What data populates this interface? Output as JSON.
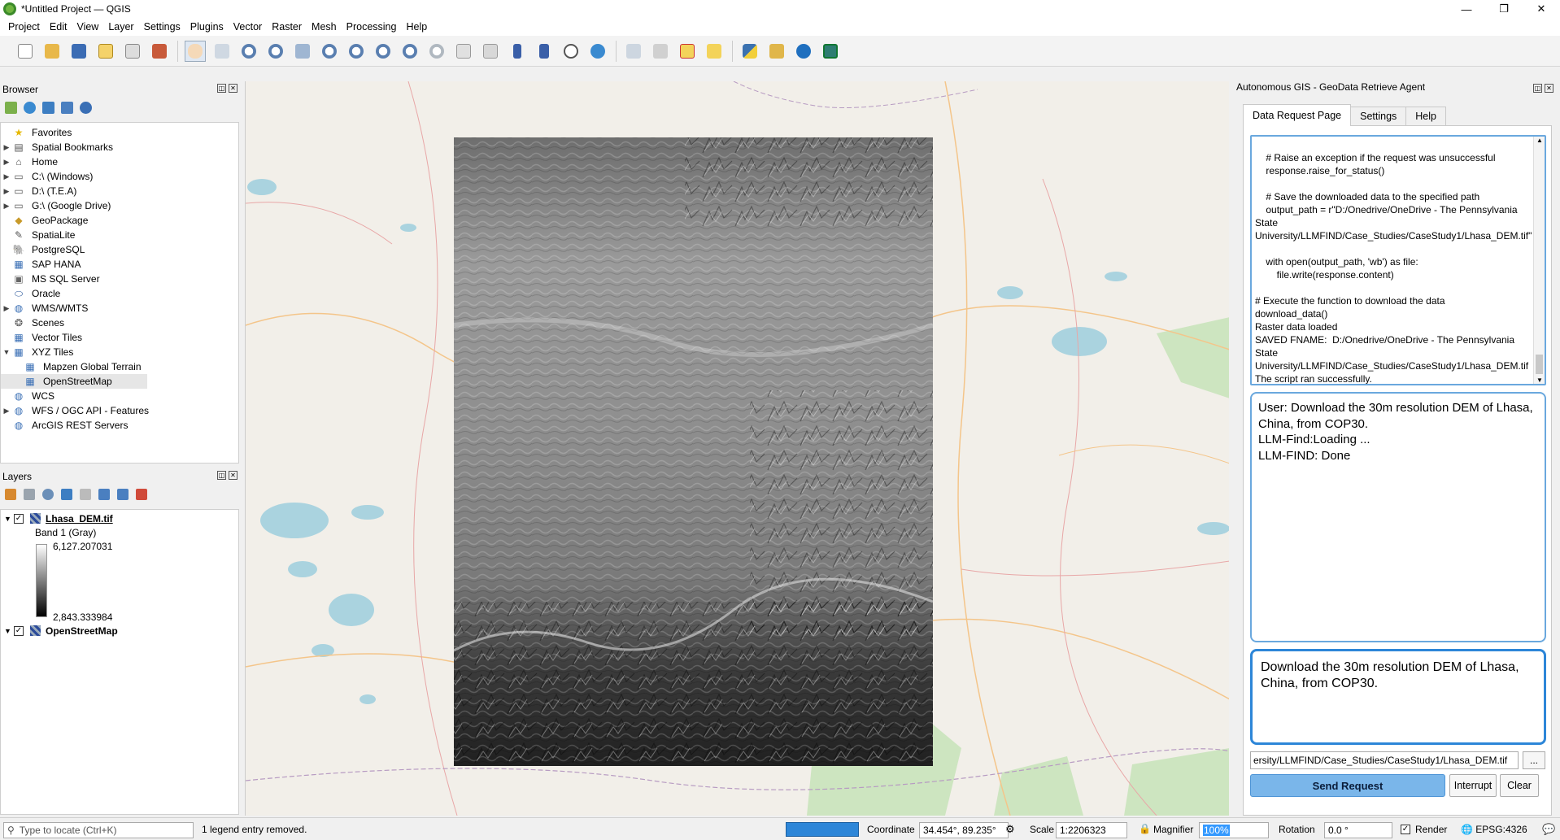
{
  "window": {
    "title": "*Untitled Project — QGIS",
    "controls": [
      "—",
      "❐",
      "✕"
    ]
  },
  "menu": [
    "Project",
    "Edit",
    "View",
    "Layer",
    "Settings",
    "Plugins",
    "Vector",
    "Raster",
    "Mesh",
    "Processing",
    "Help"
  ],
  "browser": {
    "title": "Browser",
    "items": [
      {
        "label": "Favorites",
        "icon": "star-icon",
        "expand": ""
      },
      {
        "label": "Spatial Bookmarks",
        "icon": "bookmark-icon",
        "expand": "▶"
      },
      {
        "label": "Home",
        "icon": "folder-icon",
        "expand": "▶"
      },
      {
        "label": "C:\\ (Windows)",
        "icon": "drive-icon",
        "expand": "▶"
      },
      {
        "label": "D:\\ (T.E.A)",
        "icon": "drive-icon",
        "expand": "▶"
      },
      {
        "label": "G:\\ (Google Drive)",
        "icon": "drive-icon",
        "expand": "▶"
      },
      {
        "label": "GeoPackage",
        "icon": "geopackage-icon",
        "expand": ""
      },
      {
        "label": "SpatiaLite",
        "icon": "spatialite-icon",
        "expand": ""
      },
      {
        "label": "PostgreSQL",
        "icon": "postgresql-icon",
        "expand": ""
      },
      {
        "label": "SAP HANA",
        "icon": "sap-hana-icon",
        "expand": ""
      },
      {
        "label": "MS SQL Server",
        "icon": "mssql-icon",
        "expand": ""
      },
      {
        "label": "Oracle",
        "icon": "oracle-icon",
        "expand": ""
      },
      {
        "label": "WMS/WMTS",
        "icon": "globe-icon",
        "expand": "▶"
      },
      {
        "label": "Scenes",
        "icon": "scenes-icon",
        "expand": ""
      },
      {
        "label": "Vector Tiles",
        "icon": "vector-tiles-icon",
        "expand": ""
      },
      {
        "label": "XYZ Tiles",
        "icon": "xyz-tiles-icon",
        "expand": "▼"
      },
      {
        "label": "Mapzen Global Terrain",
        "icon": "tile-layer-icon",
        "expand": "",
        "child": true
      },
      {
        "label": "OpenStreetMap",
        "icon": "tile-layer-icon",
        "expand": "",
        "child": true,
        "selected": true
      },
      {
        "label": "WCS",
        "icon": "globe-icon",
        "expand": ""
      },
      {
        "label": "WFS / OGC API - Features",
        "icon": "globe-icon",
        "expand": "▶"
      },
      {
        "label": "ArcGIS REST Servers",
        "icon": "globe-icon",
        "expand": ""
      }
    ]
  },
  "layers": {
    "title": "Layers",
    "layer1": {
      "name": "Lhasa_DEM.tif",
      "band": "Band 1 (Gray)",
      "max": "6,127.207031",
      "min": "2,843.333984"
    },
    "layer2": {
      "name": "OpenStreetMap"
    }
  },
  "dock": {
    "title": "Autonomous GIS - GeoData Retrieve Agent",
    "tabs": [
      "Data Request Page",
      "Settings",
      "Help"
    ],
    "code_log": "    # Raise an exception if the request was unsuccessful\n    response.raise_for_status()\n\n    # Save the downloaded data to the specified path\n    output_path = r\"D:/Onedrive/OneDrive - The Pennsylvania State University/LLMFIND/Case_Studies/CaseStudy1/Lhasa_DEM.tif\"\n\n    with open(output_path, 'wb') as file:\n        file.write(response.content)\n\n# Execute the function to download the data\ndownload_data()\nRaster data loaded\nSAVED FNAME:  D:/Onedrive/OneDrive - The Pennsylvania State University/LLMFIND/Case_Studies/CaseStudy1/Lhasa_DEM.tif\nThe script ran successfully.",
    "chat": [
      "User: Download the 30m resolution DEM of Lhasa, China, from COP30.",
      "LLM-Find:Loading ...",
      "LLM-FIND: Done"
    ],
    "input_text": "Download the 30m resolution DEM of Lhasa, China, from COP30.",
    "path_value": "ersity/LLMFIND/Case_Studies/CaseStudy1/Lhasa_DEM.tif",
    "browse_label": "...",
    "send_label": "Send Request",
    "interrupt_label": "Interrupt",
    "clear_label": "Clear"
  },
  "status": {
    "locate_placeholder": "Type to locate (Ctrl+K)",
    "message": "1 legend entry removed.",
    "coordinate_label": "Coordinate",
    "coordinate_value": "34.454°, 89.235°",
    "scale_label": "Scale",
    "scale_value": "1:2206323",
    "magnifier_label": "Magnifier",
    "magnifier_value": "100%",
    "rotation_label": "Rotation",
    "rotation_value": "0.0 °",
    "render_label": "Render",
    "crs": "EPSG:4326"
  },
  "colors": {
    "accent": "#2d86d8",
    "send_button": "#7ab6ea",
    "map_bg": "#f2efe9",
    "water": "#aad3df"
  }
}
